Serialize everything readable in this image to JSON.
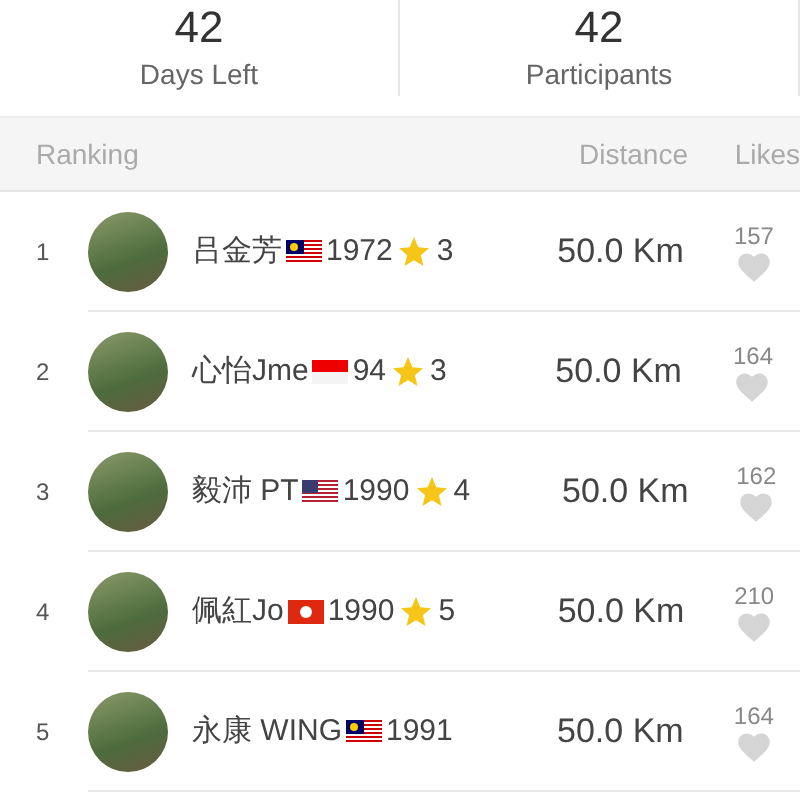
{
  "stats": [
    {
      "value": "42",
      "label": "Days Left"
    },
    {
      "value": "42",
      "label": "Participants"
    }
  ],
  "table": {
    "columns": [
      "Ranking",
      "Distance",
      "Likes"
    ],
    "rows": [
      {
        "rank": "1",
        "name": "吕金芳",
        "flag": {
          "kind": "malaysia"
        },
        "year": "1972",
        "star_count": "3",
        "distance": "50.0 Km",
        "likes": "157"
      },
      {
        "rank": "2",
        "name": "心怡Jme",
        "flag": {
          "kind": "indonesia"
        },
        "year": "94",
        "star_count": "3",
        "distance": "50.0 Km",
        "likes": "164"
      },
      {
        "rank": "3",
        "name": "毅沛 PT",
        "flag": {
          "kind": "usa"
        },
        "year": "1990",
        "star_count": "4",
        "distance": "50.0 Km",
        "likes": "162"
      },
      {
        "rank": "4",
        "name": "佩紅Jo",
        "flag": {
          "kind": "hongkong"
        },
        "year": "1990",
        "star_count": "5",
        "distance": "50.0 Km",
        "likes": "210"
      },
      {
        "rank": "5",
        "name": "永康 WING",
        "flag": {
          "kind": "malaysia"
        },
        "year": "1991",
        "distance": "50.0 Km",
        "likes": "164"
      }
    ]
  }
}
